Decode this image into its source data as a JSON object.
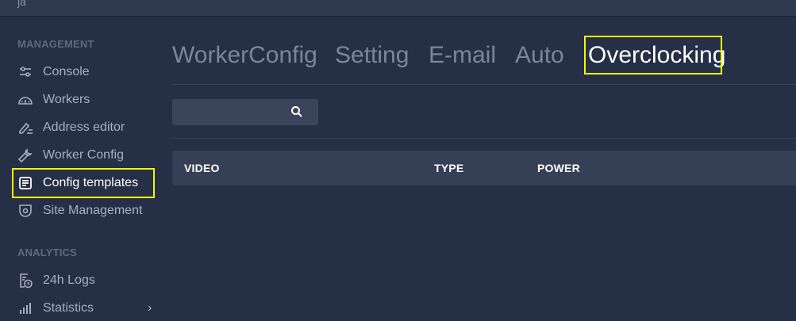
{
  "topbar": {
    "fragment": "ja"
  },
  "sidebar": {
    "management_title": "MANAGEMENT",
    "analytics_title": "ANALYTICS",
    "items": [
      {
        "label": "Console",
        "icon": "sliders-icon"
      },
      {
        "label": "Workers",
        "icon": "dashboard-icon"
      },
      {
        "label": "Address editor",
        "icon": "edit-list-icon"
      },
      {
        "label": "Worker Config",
        "icon": "wrench-icon"
      },
      {
        "label": "Config templates",
        "icon": "template-doc-icon"
      },
      {
        "label": "Site Management",
        "icon": "cctv-icon"
      }
    ],
    "analytics_items": [
      {
        "label": "24h Logs",
        "icon": "log-clock-icon"
      },
      {
        "label": "Statistics",
        "icon": "bar-chart-icon"
      }
    ]
  },
  "tabs": [
    "WorkerConfig",
    "Setting",
    "E-mail",
    "Auto",
    "Overclocking"
  ],
  "search": {
    "placeholder": ""
  },
  "table": {
    "headers": [
      "VIDEO",
      "TYPE",
      "POWER"
    ]
  },
  "colors": {
    "highlight": "#f7f400",
    "background": "#252f45",
    "active_text": "#ffffff"
  }
}
